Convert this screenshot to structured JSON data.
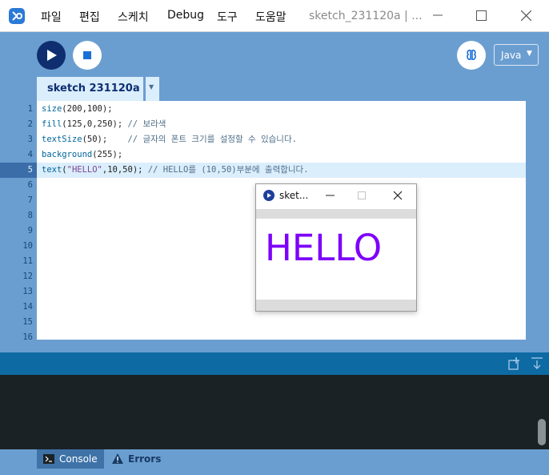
{
  "menu": {
    "items": [
      "파일",
      "편집",
      "스케치",
      "Debug",
      "도구",
      "도움말"
    ],
    "window_title": "sketch_231120a | ..."
  },
  "toolbar": {
    "mode_label": "Java",
    "icons": {
      "run": "play-icon",
      "stop": "stop-icon",
      "debug": "butterfly-icon"
    }
  },
  "tabs": {
    "active_label": "sketch 231120a",
    "menu_arrow": "▼"
  },
  "editor": {
    "current_line": 5,
    "line_numbers": [
      "1",
      "2",
      "3",
      "4",
      "5",
      "6",
      "7",
      "8",
      "9",
      "10",
      "11",
      "12",
      "13",
      "14",
      "15",
      "16"
    ],
    "lines": [
      [
        {
          "t": "size",
          "c": "fn"
        },
        {
          "t": "(200,100);",
          "c": ""
        }
      ],
      [
        {
          "t": "fill",
          "c": "fn"
        },
        {
          "t": "(125,0,250); ",
          "c": ""
        },
        {
          "t": "// 보라색",
          "c": "cm"
        }
      ],
      [
        {
          "t": "textSize",
          "c": "fn"
        },
        {
          "t": "(50);    ",
          "c": ""
        },
        {
          "t": "// 글자의 폰트 크기를 설정할 수 있습니다.",
          "c": "cm"
        }
      ],
      [
        {
          "t": "background",
          "c": "fn"
        },
        {
          "t": "(255);",
          "c": ""
        }
      ],
      [
        {
          "t": "text",
          "c": "fn"
        },
        {
          "t": "(",
          "c": ""
        },
        {
          "t": "\"HELLO\"",
          "c": "str"
        },
        {
          "t": ",10,50); ",
          "c": ""
        },
        {
          "t": "// HELLO를 (10,50)부분에 출력합니다.",
          "c": "cm"
        }
      ]
    ]
  },
  "console": {
    "tabs": {
      "console_label": "Console",
      "errors_label": "Errors"
    }
  },
  "sketch_window": {
    "title": "sket...",
    "output_text": "HELLO",
    "text_color": "#7d00fa"
  },
  "colors": {
    "accent_dark": "#0e2e6f",
    "app_background": "#6b9ed0",
    "console_background": "#1b2226",
    "console_header": "#0d6aa3"
  }
}
